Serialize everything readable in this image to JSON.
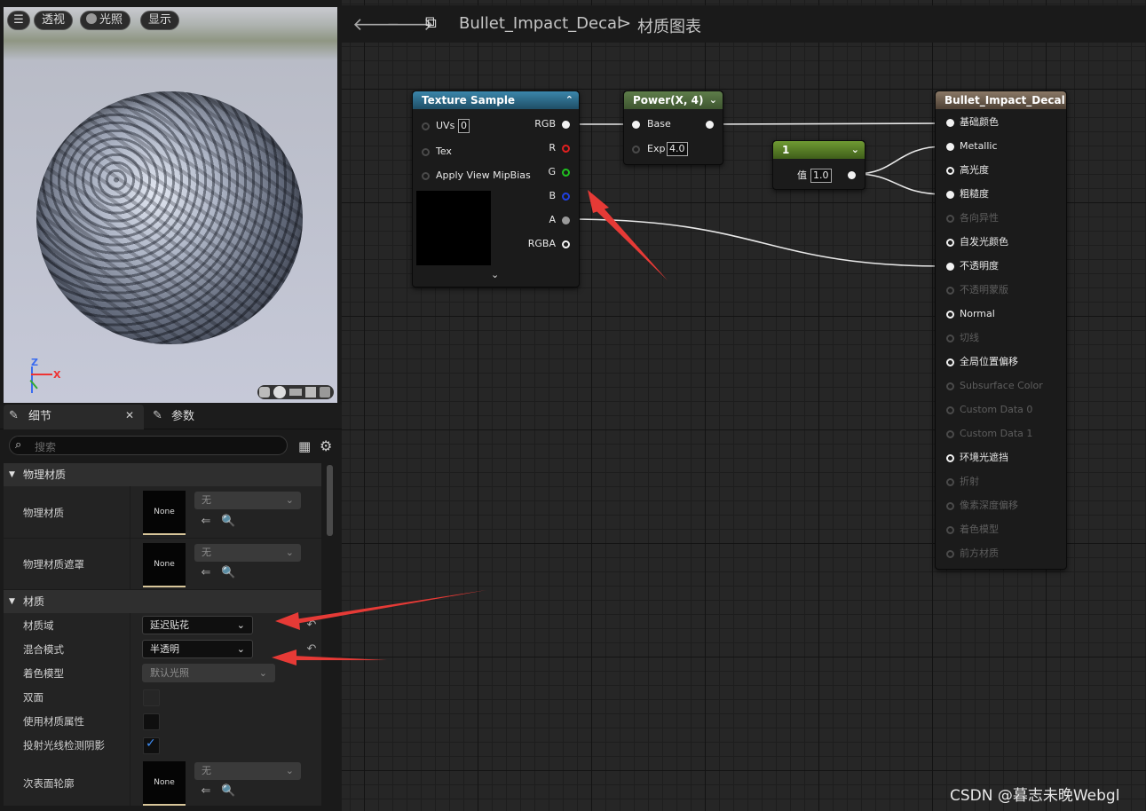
{
  "viewport": {
    "buttons": [
      "透视",
      "光照",
      "显示"
    ],
    "axes": {
      "z": "Z",
      "x": "X"
    }
  },
  "details": {
    "tabs": [
      "细节",
      "参数"
    ],
    "search_placeholder": "搜索",
    "sections": {
      "physical": "物理材质",
      "material": "材质"
    },
    "rows": {
      "phys_material": {
        "label": "物理材质",
        "thumb": "None",
        "value": "无"
      },
      "phys_mask": {
        "label": "物理材质遮罩",
        "thumb": "None",
        "value": "无"
      },
      "domain": {
        "label": "材质域",
        "value": "延迟贴花"
      },
      "blend": {
        "label": "混合模式",
        "value": "半透明"
      },
      "shading": {
        "label": "着色模型",
        "value": "默认光照"
      },
      "two_sided": {
        "label": "双面"
      },
      "use_attrs": {
        "label": "使用材质属性"
      },
      "raytrace": {
        "label": "投射光线检测阴影"
      },
      "subsurface": {
        "label": "次表面轮廓",
        "thumb": "None",
        "value": "无"
      }
    }
  },
  "graph": {
    "breadcrumb": {
      "asset": "Bullet_Impact_Decal",
      "separator": ">",
      "page": "材质图表"
    },
    "texture_sample": {
      "title": "Texture Sample",
      "inputs": [
        {
          "label": "UVs",
          "value": "0"
        },
        {
          "label": "Tex"
        },
        {
          "label": "Apply View MipBias"
        }
      ],
      "outputs": [
        "RGB",
        "R",
        "G",
        "B",
        "A",
        "RGBA"
      ]
    },
    "power": {
      "title": "Power(X, 4)",
      "base": "Base",
      "exp": "Exp",
      "exp_value": "4.0"
    },
    "constant": {
      "title": "1",
      "label": "值",
      "value": "1.0"
    },
    "result": {
      "title": "Bullet_Impact_Decal",
      "pins": [
        {
          "label": "基础颜色",
          "active": true
        },
        {
          "label": "Metallic",
          "active": true
        },
        {
          "label": "高光度",
          "active": true
        },
        {
          "label": "粗糙度",
          "active": true
        },
        {
          "label": "各向异性",
          "active": false
        },
        {
          "label": "自发光颜色",
          "active": true
        },
        {
          "label": "不透明度",
          "active": true
        },
        {
          "label": "不透明蒙版",
          "active": false
        },
        {
          "label": "Normal",
          "active": true
        },
        {
          "label": "切线",
          "active": false
        },
        {
          "label": "全局位置偏移",
          "active": true
        },
        {
          "label": "Subsurface Color",
          "active": false
        },
        {
          "label": "Custom Data 0",
          "active": false
        },
        {
          "label": "Custom Data 1",
          "active": false
        },
        {
          "label": "环境光遮挡",
          "active": true
        },
        {
          "label": "折射",
          "active": false
        },
        {
          "label": "像素深度偏移",
          "active": false
        },
        {
          "label": "着色模型",
          "active": false
        },
        {
          "label": "前方材质",
          "active": false
        }
      ]
    },
    "watermark": "CSDN @暮志未晚Webgl"
  },
  "colors": {
    "accent_red": "#e63a36",
    "texture_header": "#2f6f8f",
    "power_header": "#4d6a3a",
    "constant_header": "#5b7d2a",
    "result_header": "#6e5f4e"
  }
}
